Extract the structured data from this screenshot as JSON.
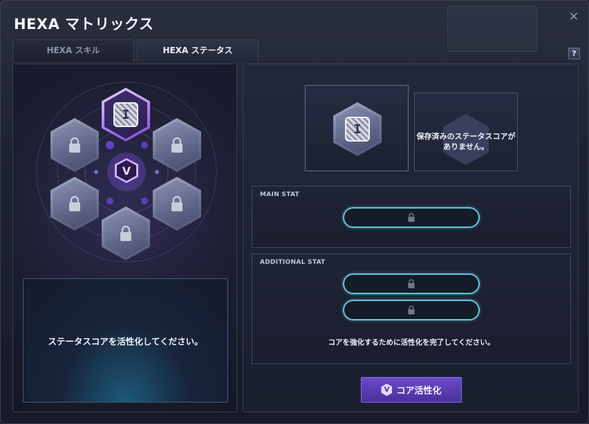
{
  "window": {
    "title": "HEXA マトリックス",
    "close_icon": "×",
    "help_label": "?"
  },
  "tabs": [
    {
      "label": "HEXA スキル",
      "active": false
    },
    {
      "label": "HEXA ステータス",
      "active": true
    }
  ],
  "left_panel": {
    "emblem_glyph": "V",
    "core_glyph": "I",
    "core_dots": "oo",
    "info_text": "ステータスコアを活性化してください。"
  },
  "right_panel": {
    "saved_text_line1": "保存済みのステータスコアが",
    "saved_text_line2": "ありません。",
    "main_stat_label": "MAIN STAT",
    "additional_stat_label": "ADDITIONAL STAT",
    "hint_text": "コアを強化するために活性化を完了してください。",
    "activate_button_label": "コア活性化",
    "activate_button_icon": "V"
  },
  "colors": {
    "accent_purple": "#6a4bc8",
    "stat_slot_border": "#5fc7d8",
    "active_hex": "#b484f0"
  }
}
